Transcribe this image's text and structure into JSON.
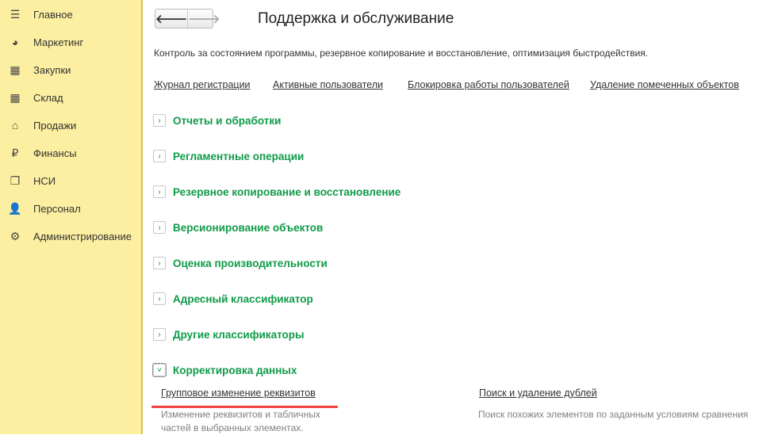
{
  "sidebar": {
    "items": [
      {
        "label": "Главное",
        "icon": "menu-icon"
      },
      {
        "label": "Маркетинг",
        "icon": "pie-chart-icon"
      },
      {
        "label": "Закупки",
        "icon": "cart-icon"
      },
      {
        "label": "Склад",
        "icon": "warehouse-icon"
      },
      {
        "label": "Продажи",
        "icon": "basket-icon"
      },
      {
        "label": "Финансы",
        "icon": "ruble-icon"
      },
      {
        "label": "НСИ",
        "icon": "documents-icon"
      },
      {
        "label": "Персонал",
        "icon": "person-icon"
      },
      {
        "label": "Администрирование",
        "icon": "gear-icon"
      }
    ]
  },
  "header": {
    "back": "🡐",
    "forward": "🡒",
    "title": "Поддержка и обслуживание",
    "description": "Контроль за состоянием программы, резервное копирование и восстановление, оптимизация быстродействия."
  },
  "links": [
    "Журнал регистрации",
    "Активные пользователи",
    "Блокировка работы пользователей",
    "Удаление помеченных объектов"
  ],
  "sections": [
    {
      "label": "Отчеты и обработки",
      "expanded": false
    },
    {
      "label": "Регламентные операции",
      "expanded": false
    },
    {
      "label": "Резервное копирование и восстановление",
      "expanded": false
    },
    {
      "label": "Версионирование объектов",
      "expanded": false
    },
    {
      "label": "Оценка производительности",
      "expanded": false
    },
    {
      "label": "Адресный классификатор",
      "expanded": false
    },
    {
      "label": "Другие классификаторы",
      "expanded": false
    },
    {
      "label": "Корректировка данных",
      "expanded": true
    }
  ],
  "chevrons": {
    "collapsed": "›",
    "expanded": "˅"
  },
  "data_correction": {
    "items": [
      {
        "label": "Групповое изменение реквизитов",
        "description": "Изменение реквизитов и табличных частей в выбранных элементах."
      },
      {
        "label": "Поиск и удаление дублей",
        "description": "Поиск похожих элементов по заданным условиям сравнения"
      }
    ]
  },
  "colors": {
    "sidebar": "#FCEFA1",
    "section": "#0F9A48",
    "highlight": "#F04040"
  }
}
